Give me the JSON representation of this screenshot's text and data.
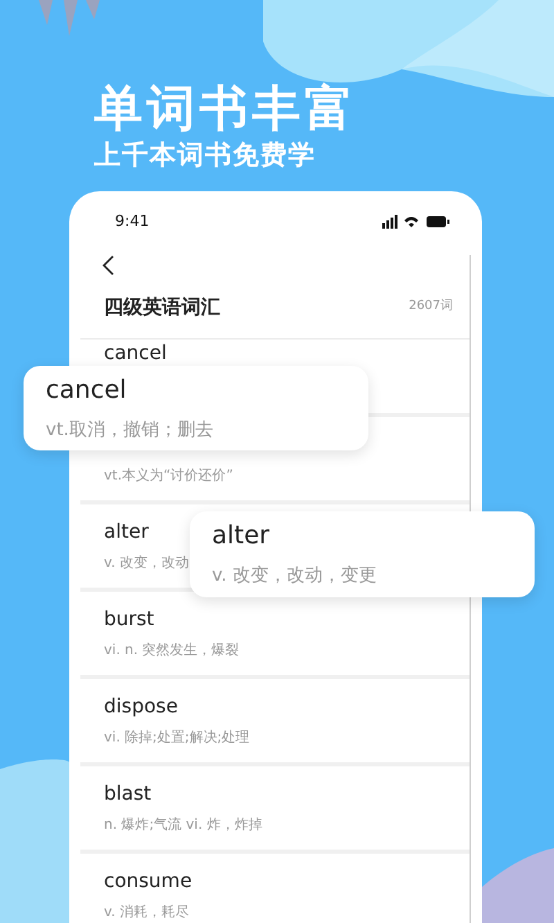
{
  "hero": {
    "title": "单词书丰富",
    "subtitle": "上千本词书免费学"
  },
  "phone": {
    "status_bar": {
      "time": "9:41"
    },
    "header": {
      "title": "四级英语词汇",
      "count": "2607词"
    },
    "words": [
      {
        "word": "cancel"
      },
      {
        "meaning": "vt.本义为“讨价还价”"
      },
      {
        "word": "alter",
        "meaning": "v. 改变，改动"
      },
      {
        "word": "burst",
        "meaning": "vi. n. 突然发生，爆裂"
      },
      {
        "word": "dispose",
        "meaning": "vi. 除掉;处置;解决;处理"
      },
      {
        "word": "blast",
        "meaning": "n. 爆炸;气流 vi. 炸，炸掉"
      },
      {
        "word": "consume",
        "meaning": "v. 消耗，耗尽"
      }
    ]
  },
  "popups": [
    {
      "word": "cancel",
      "meaning": "vt.取消，撤销；删去"
    },
    {
      "word": "alter",
      "meaning": "v. 改变，改动，变更"
    }
  ]
}
